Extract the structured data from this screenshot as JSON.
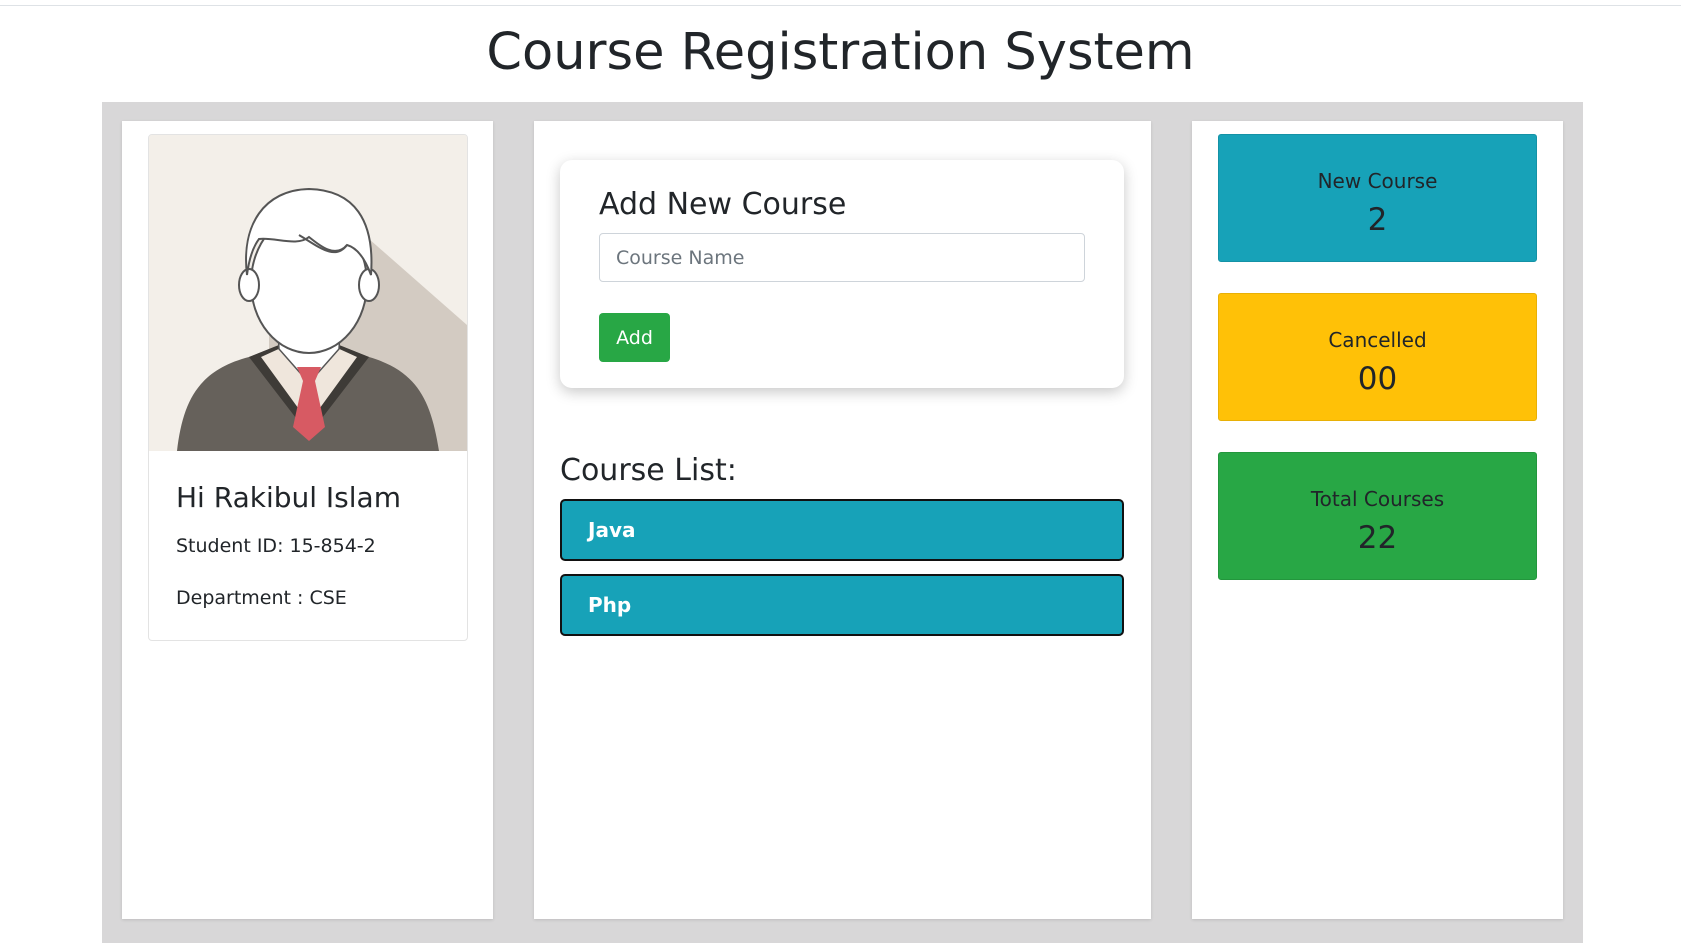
{
  "header": {
    "title": "Course Registration System"
  },
  "profile": {
    "avatar_icon": "student-avatar-icon",
    "greeting": "Hi Rakibul Islam",
    "student_id": "Student ID: 15-854-2",
    "department": "Department : CSE"
  },
  "add_course": {
    "title": "Add New Course",
    "input_placeholder": "Course Name",
    "input_value": "",
    "button_label": "Add"
  },
  "course_list": {
    "heading": "Course List:",
    "items": [
      {
        "label": "Java"
      },
      {
        "label": "Php"
      }
    ]
  },
  "stats": {
    "new_course": {
      "label": "New Course",
      "value": "2"
    },
    "cancelled": {
      "label": "Cancelled",
      "value": "00"
    },
    "total_courses": {
      "label": "Total Courses",
      "value": "22"
    }
  },
  "colors": {
    "info": "#17a2b8",
    "warning": "#ffc107",
    "success": "#28a745",
    "board_background": "#d8d7d8"
  }
}
